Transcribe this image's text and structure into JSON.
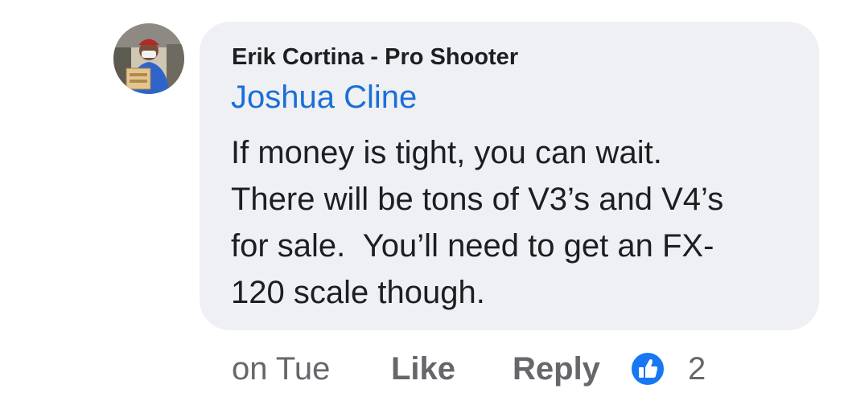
{
  "comment": {
    "author": "Erik Cortina - Pro Shooter",
    "mention": "Joshua Cline",
    "body_lines": [
      "If money is tight, you can wait.",
      "There will be tons of V3’s and V4’s",
      "for sale.  You’ll need to get an FX-",
      "120 scale though."
    ]
  },
  "actions": {
    "timestamp": "on Tue",
    "like_label": "Like",
    "reply_label": "Reply",
    "reaction_icon": "like-thumbs-up-icon",
    "reaction_count": "2"
  },
  "colors": {
    "bubble_bg": "#eff0f3",
    "mention": "#1a6ed8",
    "secondary_text": "#65676b",
    "like_badge": "#1877f2"
  }
}
